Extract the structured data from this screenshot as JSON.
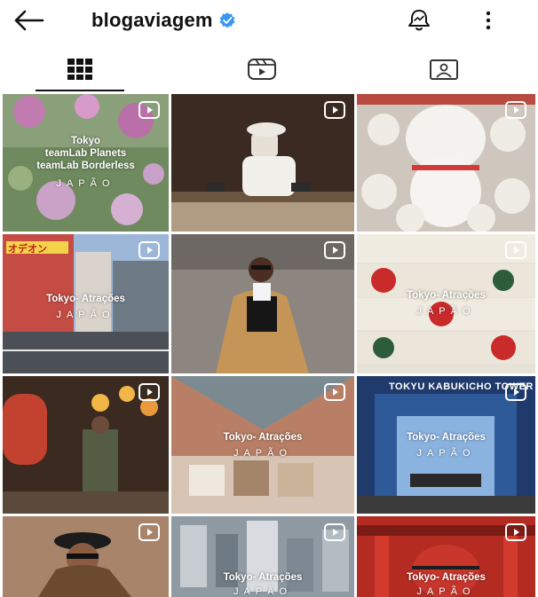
{
  "header": {
    "back_icon": "arrow-left-icon",
    "username": "blogaviagem",
    "verified_icon": "verified-badge-icon",
    "notification_icon": "bell-icon",
    "more_icon": "more-vertical-icon"
  },
  "tabs": [
    {
      "name": "posts",
      "icon": "grid-icon",
      "selected": true
    },
    {
      "name": "reels",
      "icon": "reels-icon",
      "selected": false
    },
    {
      "name": "tagged",
      "icon": "tagged-user-icon",
      "selected": false
    }
  ],
  "posts": [
    {
      "caption_lines": [
        "Tokyo",
        "teamLab Planets",
        "teamLab Borderless"
      ],
      "sub": "JAPÃO"
    },
    {
      "caption_lines": [],
      "sub": ""
    },
    {
      "caption_lines": [],
      "sub": ""
    },
    {
      "caption_lines": [
        "Tokyo- Atrações"
      ],
      "sub": "JAPÃO",
      "sign": "オデオン"
    },
    {
      "caption_lines": [],
      "sub": ""
    },
    {
      "caption_lines": [
        "Tokyo- Atrações"
      ],
      "sub": "JAPÃO"
    },
    {
      "caption_lines": [],
      "sub": ""
    },
    {
      "caption_lines": [
        "Tokyo- Atrações"
      ],
      "sub": "JAPÃO"
    },
    {
      "caption_lines": [
        "Tokyo- Atrações"
      ],
      "sub": "JAPÃO",
      "sign": "TOKYU KABUKICHO TOWER"
    },
    {
      "caption_lines": [],
      "sub": ""
    },
    {
      "caption_lines": [
        "Tokyo- Atrações"
      ],
      "sub": "JAPÃO"
    },
    {
      "caption_lines": [
        "Tokyo- Atrações"
      ],
      "sub": "JAPÃO"
    }
  ],
  "colors": {
    "accent": "#3897f0",
    "text": "#111111"
  }
}
